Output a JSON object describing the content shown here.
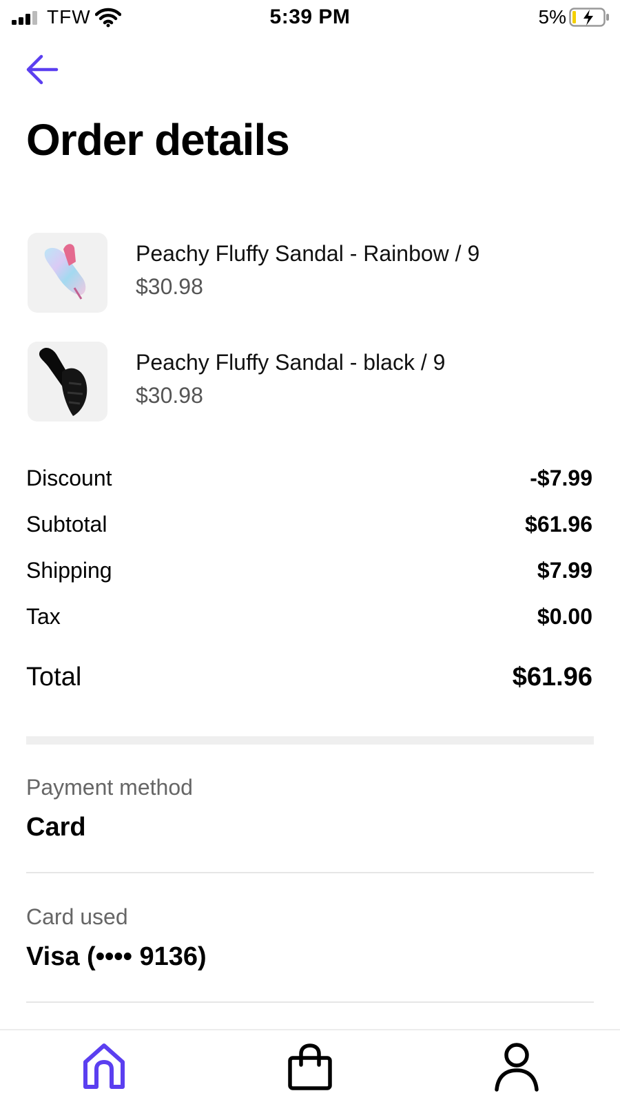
{
  "status_bar": {
    "carrier": "TFW",
    "time": "5:39 PM",
    "battery_percent": "5%"
  },
  "header": {
    "title": "Order details",
    "back_icon": "arrow-left-icon"
  },
  "items": [
    {
      "name": "Peachy Fluffy Sandal - Rainbow / 9",
      "price": "$30.98",
      "thumb": "rainbow-sandal"
    },
    {
      "name": "Peachy Fluffy Sandal - black / 9",
      "price": "$30.98",
      "thumb": "black-sandal"
    }
  ],
  "summary": {
    "discount": {
      "label": "Discount",
      "value": "-$7.99"
    },
    "subtotal": {
      "label": "Subtotal",
      "value": "$61.96"
    },
    "shipping": {
      "label": "Shipping",
      "value": "$7.99"
    },
    "tax": {
      "label": "Tax",
      "value": "$0.00"
    },
    "total": {
      "label": "Total",
      "value": "$61.96"
    }
  },
  "payment": {
    "method_label": "Payment method",
    "method_value": "Card",
    "card_label": "Card used",
    "card_value": "Visa (•••• 9136)"
  },
  "bottom_nav": {
    "items": [
      "home-icon",
      "shopping-bag-icon",
      "profile-icon"
    ]
  },
  "colors": {
    "accent": "#5b3ff0",
    "text": "#000000",
    "muted": "#555555"
  }
}
